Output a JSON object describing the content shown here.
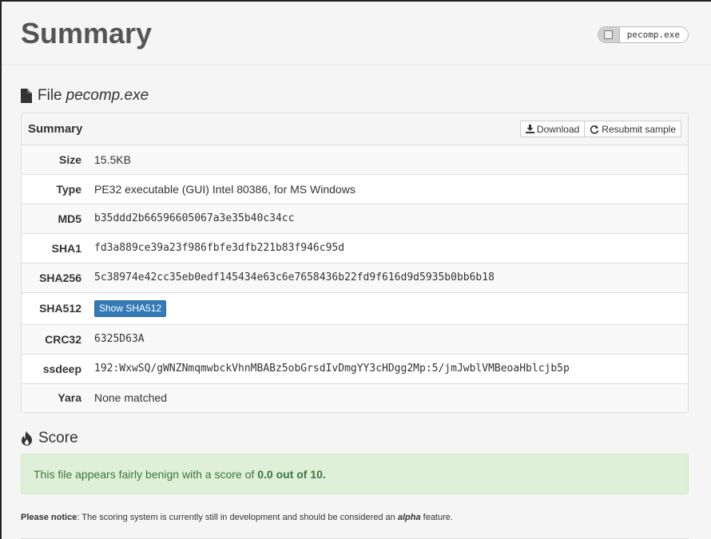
{
  "header": {
    "title": "Summary",
    "file_badge": "pecomp.exe"
  },
  "file_section": {
    "label": "File",
    "filename": "pecomp.exe"
  },
  "summary_panel": {
    "title": "Summary",
    "download_label": "Download",
    "resubmit_label": "Resubmit sample",
    "rows": {
      "size": {
        "label": "Size",
        "value": "15.5KB"
      },
      "type": {
        "label": "Type",
        "value": "PE32 executable (GUI) Intel 80386, for MS Windows"
      },
      "md5": {
        "label": "MD5",
        "value": "b35ddd2b66596605067a3e35b40c34cc"
      },
      "sha1": {
        "label": "SHA1",
        "value": "fd3a889ce39a23f986fbfe3dfb221b83f946c95d"
      },
      "sha256": {
        "label": "SHA256",
        "value": "5c38974e42cc35eb0edf145434e63c6e7658436b22fd9f616d9d5935b0bb6b18"
      },
      "sha512": {
        "label": "SHA512",
        "button_label": "Show SHA512"
      },
      "crc32": {
        "label": "CRC32",
        "value": "6325D63A"
      },
      "ssdeep": {
        "label": "ssdeep",
        "value": "192:WxwSQ/gWNZNmqmwbckVhnMBABz5obGrsdIvDmgYY3cHDgg2Mp:5/jmJwblVMBeoaHblcjb5p"
      },
      "yara": {
        "label": "Yara",
        "value": "None matched"
      }
    }
  },
  "score_section": {
    "title": "Score",
    "message_prefix": "This file appears fairly benign with a score of",
    "score_text": "0.0 out of 10."
  },
  "notice": {
    "label": "Please notice",
    "text_before": ": The scoring system is currently still in development and should be considered an",
    "alpha": "alpha",
    "text_after": "feature."
  },
  "colors": {
    "primary_button": "#337ab7",
    "success_bg": "#dff0d8",
    "success_text": "#3c763d"
  }
}
